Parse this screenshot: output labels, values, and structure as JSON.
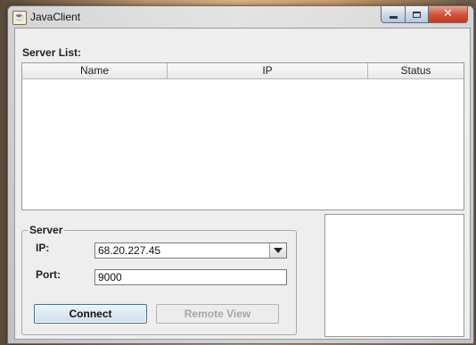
{
  "window": {
    "title": "JavaClient",
    "icon": "java-cup-icon"
  },
  "server_list": {
    "label": "Server List:",
    "columns": [
      "Name",
      "IP",
      "Status"
    ],
    "rows": []
  },
  "server": {
    "legend": "Server",
    "ip_label": "IP:",
    "ip_value": "68.20.227.45",
    "port_label": "Port:",
    "port_value": "9000",
    "connect_label": "Connect",
    "remote_view_label": "Remote View"
  }
}
